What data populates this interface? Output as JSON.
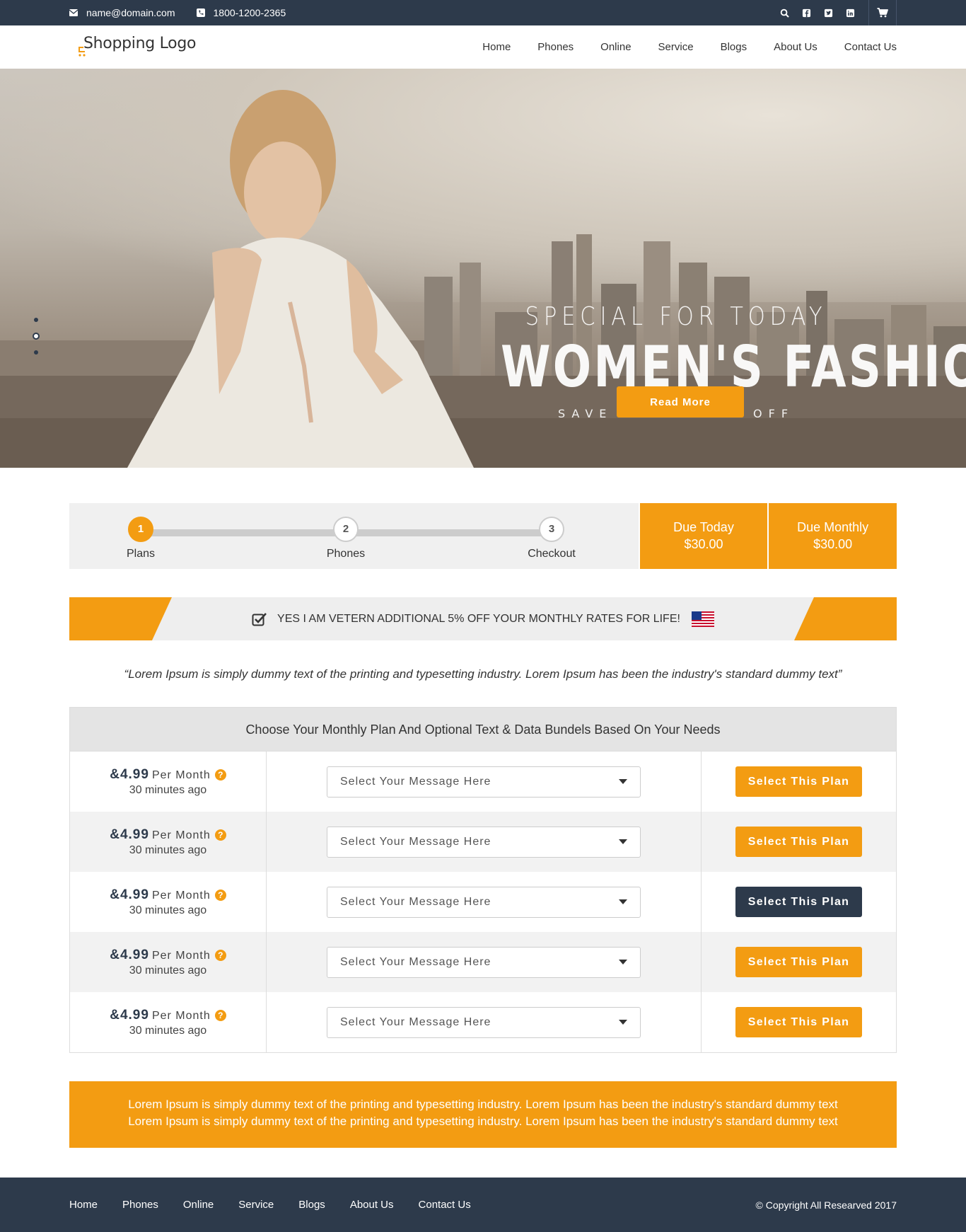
{
  "topbar": {
    "email": "name@domain.com",
    "phone": "1800-1200-2365",
    "icons": [
      "search-icon",
      "facebook-icon",
      "twitter-icon",
      "linkedin-icon",
      "cart-icon"
    ]
  },
  "header": {
    "logo": "Shopping Logo",
    "nav": [
      "Home",
      "Phones",
      "Online",
      "Service",
      "Blogs",
      "About Us",
      "Contact Us"
    ]
  },
  "hero": {
    "kicker": "SPECIAL FOR TODAY",
    "title": "WOMEN'S FASHION",
    "subtitle": "SAVE UP TO 40% OFF",
    "button": "Read More",
    "slides": 3,
    "active_slide": 2
  },
  "steps": {
    "items": [
      {
        "num": "1",
        "label": "Plans"
      },
      {
        "num": "2",
        "label": "Phones"
      },
      {
        "num": "3",
        "label": "Checkout"
      }
    ],
    "current_step": 1,
    "due_today": {
      "label": "Due Today",
      "value": "$30.00"
    },
    "due_monthly": {
      "label": "Due Monthly",
      "value": "$30.00"
    }
  },
  "veteran": {
    "text": "YES I AM VETERN ADDITIONAL 5% OFF YOUR MONTHLY RATES FOR LIFE!"
  },
  "quote": "“Lorem Ipsum is simply dummy text of the printing and typesetting industry. Lorem Ipsum has been the industry's standard dummy text”",
  "plans": {
    "heading": "Choose Your Monthly Plan And Optional Text & Data Bundels Based On Your Needs",
    "rows": [
      {
        "price": "&4.99",
        "per": "Per Month",
        "time": "30 minutes ago",
        "select": "Select Your Message Here",
        "button": "Select This Plan"
      },
      {
        "price": "&4.99",
        "per": "Per Month",
        "time": "30 minutes ago",
        "select": "Select Your Message Here",
        "button": "Select This Plan"
      },
      {
        "price": "&4.99",
        "per": "Per Month",
        "time": "30 minutes ago",
        "select": "Select Your Message Here",
        "button": "Select This Plan"
      },
      {
        "price": "&4.99",
        "per": "Per Month",
        "time": "30 minutes ago",
        "select": "Select Your Message Here",
        "button": "Select This Plan"
      },
      {
        "price": "&4.99",
        "per": "Per Month",
        "time": "30 minutes ago",
        "select": "Select Your Message Here",
        "button": "Select This Plan"
      }
    ]
  },
  "lorem_box": {
    "line1": "Lorem Ipsum is simply dummy text of the printing and typesetting industry. Lorem Ipsum has been the industry's standard dummy text",
    "line2": "Lorem Ipsum is simply dummy text of the printing and typesetting industry. Lorem Ipsum has been the industry's standard dummy text"
  },
  "footer": {
    "nav": [
      "Home",
      "Phones",
      "Online",
      "Service",
      "Blogs",
      "About Us",
      "Contact Us"
    ],
    "copyright": "Copyright All Researved 2017"
  },
  "colors": {
    "accent": "#f39c12",
    "dark": "#2d3a4b",
    "light": "#f0f0f0"
  }
}
